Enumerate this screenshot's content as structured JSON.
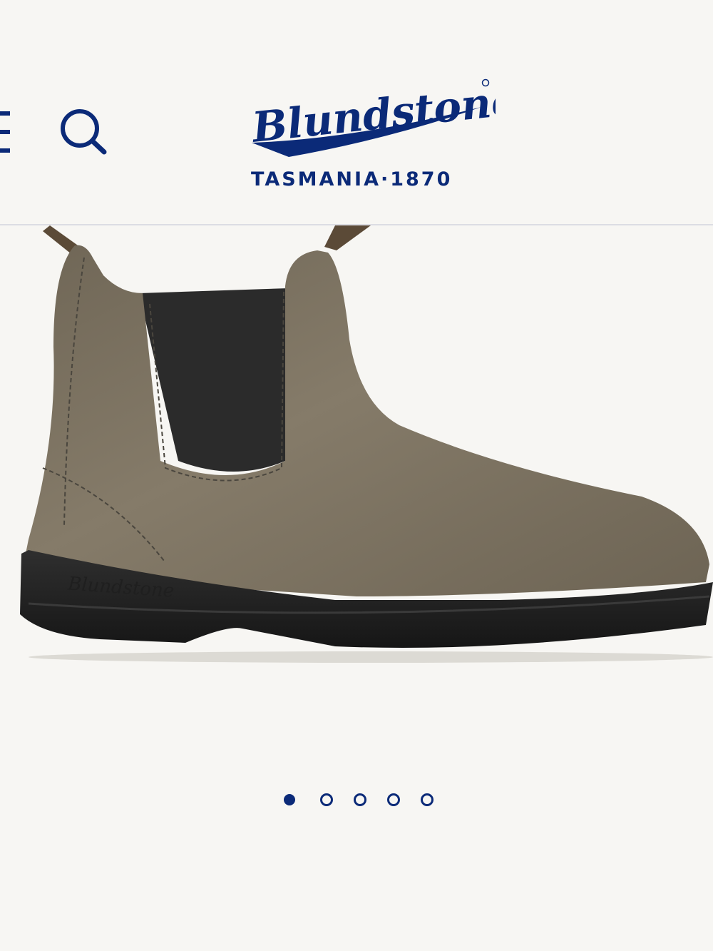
{
  "header": {
    "brand": "Blundstone",
    "tagline": "TASMANIA·1870",
    "brand_color": "#0b2a78"
  },
  "icons": {
    "menu": "hamburger-menu-icon",
    "search": "search-icon"
  },
  "gallery": {
    "image_alt": "Blundstone chelsea boot, rustic brown leather",
    "slide_count": 5,
    "active_slide": 1,
    "dots": [
      "slide-1",
      "slide-2",
      "slide-3",
      "slide-4",
      "slide-5"
    ]
  }
}
